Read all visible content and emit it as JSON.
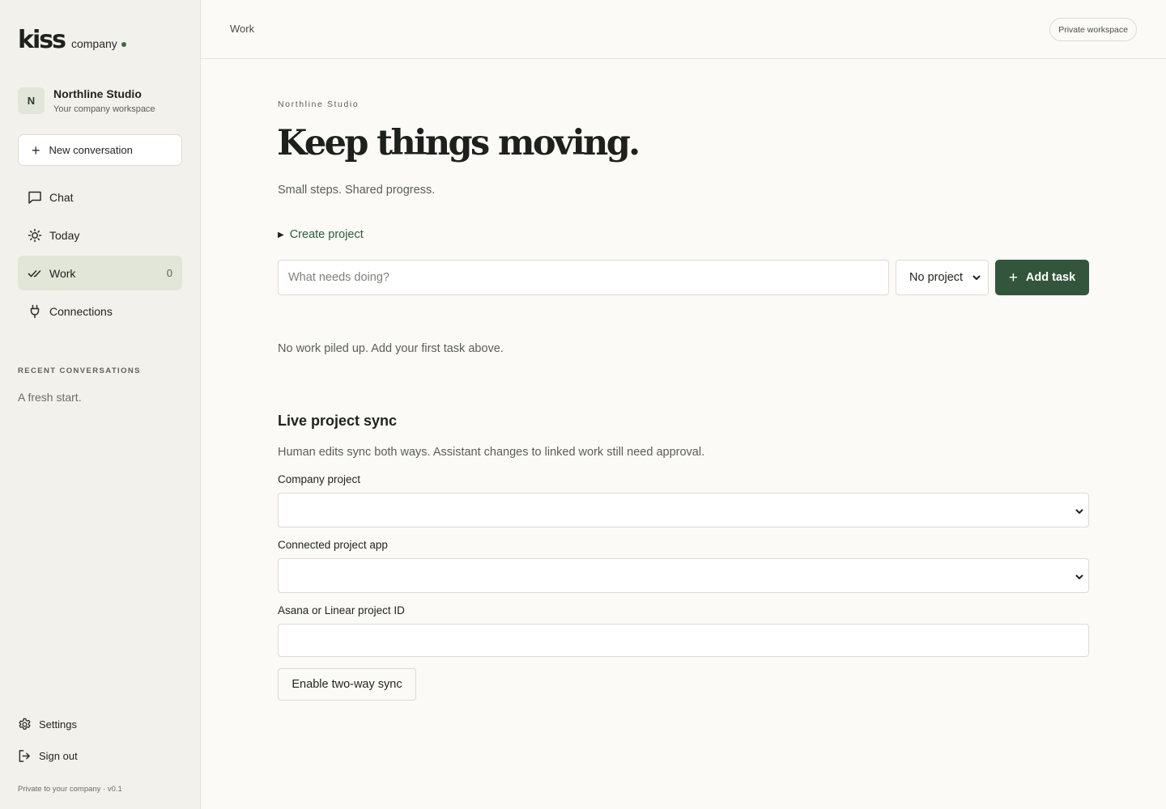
{
  "sidebar": {
    "logo": {
      "word": "kiss",
      "sub": "company"
    },
    "workspace": {
      "initial": "N",
      "name": "Northline Studio",
      "subtitle": "Your company workspace"
    },
    "new_conversation_label": "New conversation",
    "nav": [
      {
        "label": "Chat",
        "icon": "chat-bubble-icon"
      },
      {
        "label": "Today",
        "icon": "sun-icon"
      },
      {
        "label": "Work",
        "icon": "double-check-icon",
        "count": "0",
        "active": true
      },
      {
        "label": "Connections",
        "icon": "plug-icon"
      }
    ],
    "recent_label": "RECENT CONVERSATIONS",
    "recent_empty": "A fresh start.",
    "settings_label": "Settings",
    "signout_label": "Sign out",
    "footer_note": "Private to your company · v0.1"
  },
  "topbar": {
    "breadcrumb": "Work",
    "private_badge": "Private workspace"
  },
  "main": {
    "eyebrow": "Northline Studio",
    "headline": "Keep things moving.",
    "subhead": "Small steps. Shared progress.",
    "create_project_label": "Create project",
    "task_placeholder": "What needs doing?",
    "project_select_value": "No project",
    "add_task_label": "Add task",
    "empty_note": "No work piled up. Add your first task above."
  },
  "sync": {
    "title": "Live project sync",
    "description": "Human edits sync both ways. Assistant changes to linked work still need approval.",
    "company_project_label": "Company project",
    "connected_app_label": "Connected project app",
    "project_id_label": "Asana or Linear project ID",
    "enable_button": "Enable two-way sync"
  },
  "colors": {
    "accent": "#33553b",
    "sidebar_bg": "#f3f1eb",
    "page_bg": "#fbfaf6",
    "active_nav_bg": "#e2e6d8"
  }
}
